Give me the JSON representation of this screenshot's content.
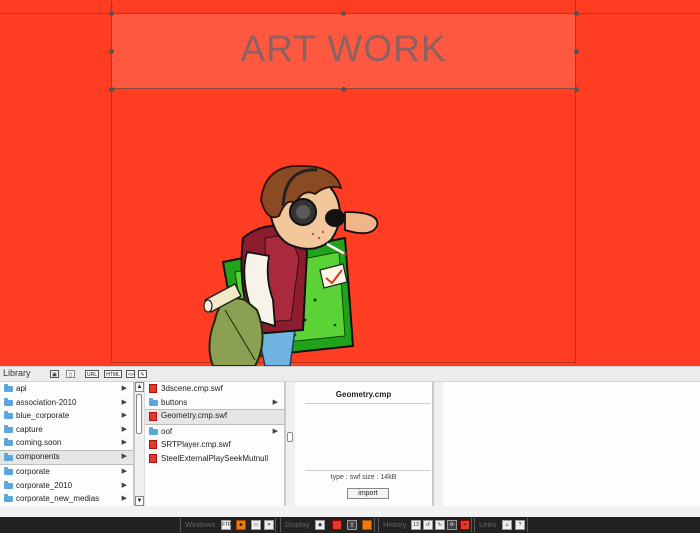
{
  "stage": {
    "title": "ART WORK",
    "background_color": "#ff3d22"
  },
  "library": {
    "label": "Library",
    "toolbar": {
      "url_label": "URL",
      "html_label": "HTML",
      "code_label": "<>"
    },
    "folders": [
      {
        "name": "api"
      },
      {
        "name": "association-2010"
      },
      {
        "name": "blue_corporate"
      },
      {
        "name": "capture"
      },
      {
        "name": "coming.soon"
      },
      {
        "name": "components"
      },
      {
        "name": "corporate"
      },
      {
        "name": "corporate_2010"
      },
      {
        "name": "corporate_new_medias"
      }
    ],
    "selected_folder": "components",
    "files": [
      {
        "name": "3dscene.cmp.swf",
        "kind": "file"
      },
      {
        "name": "buttons",
        "kind": "folder"
      },
      {
        "name": "Geometry.cmp.swf",
        "kind": "file"
      },
      {
        "name": "oof",
        "kind": "folder"
      },
      {
        "name": "SRTPlayer.cmp.swf",
        "kind": "file"
      },
      {
        "name": "SteelExternalPlaySeekMutnull",
        "kind": "file"
      }
    ],
    "selected_file": "Geometry.cmp.swf",
    "preview": {
      "title": "Geometry.cmp",
      "info": "type : swf   size : 14kB",
      "import_label": "import"
    }
  },
  "bottom_bar": {
    "windows_label": "Windows",
    "windows_btn_label": "FTP",
    "display_label": "Display",
    "history_label": "History",
    "history_count": "13",
    "links_label": "Links"
  }
}
